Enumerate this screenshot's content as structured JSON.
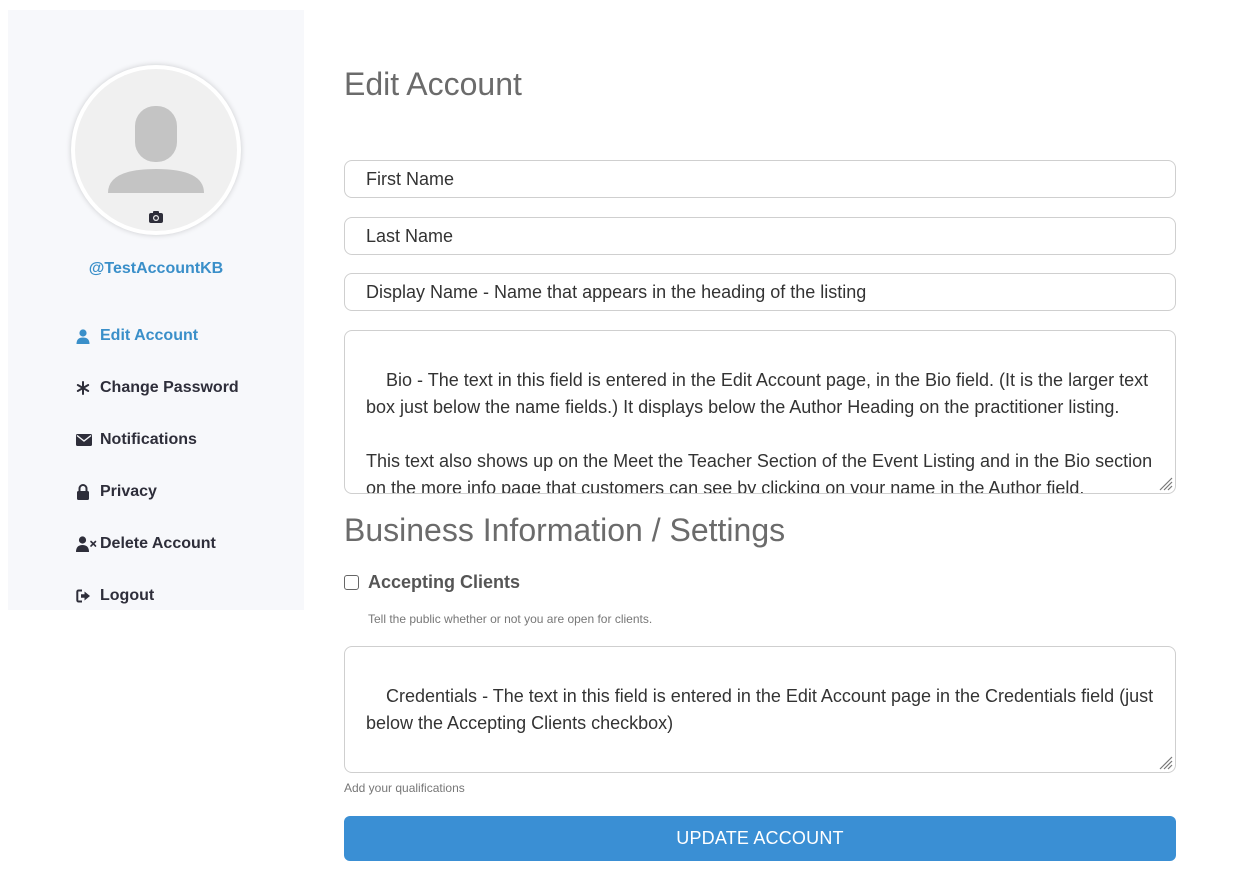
{
  "sidebar": {
    "username": "@TestAccountKB",
    "nav": [
      {
        "label": "Edit Account",
        "icon": "user-icon",
        "active": true
      },
      {
        "label": "Change Password",
        "icon": "asterisk-icon",
        "active": false
      },
      {
        "label": "Notifications",
        "icon": "envelope-icon",
        "active": false
      },
      {
        "label": "Privacy",
        "icon": "lock-icon",
        "active": false
      },
      {
        "label": "Delete Account",
        "icon": "user-times-icon",
        "active": false
      },
      {
        "label": "Logout",
        "icon": "sign-out-icon",
        "active": false
      }
    ]
  },
  "main": {
    "title": "Edit Account",
    "first_name": "First Name",
    "last_name": "Last Name",
    "display_name": "Display Name - Name that appears in the heading of the listing",
    "bio": "Bio - The text in this field is entered in the Edit Account page, in the Bio field. (It is the larger text box just below the name fields.) It displays below the Author Heading on the practitioner listing.\n\nThis text also shows up on the Meet the Teacher Section of the Event Listing and in the Bio section on the more info page that customers can see by clicking on your name in the Author field.",
    "section_title": "Business Information / Settings",
    "accepting_clients_label": "Accepting Clients",
    "accepting_clients_checked": false,
    "accepting_clients_help": "Tell the public whether or not you are open for clients.",
    "credentials": "Credentials - The text in this field is entered in the Edit Account page in the Credentials field (just below the Accepting Clients checkbox)",
    "credentials_help": "Add your qualifications",
    "update_button": "UPDATE ACCOUNT"
  },
  "colors": {
    "accent": "#3a8fc9",
    "button": "#3a8fd4",
    "sidebar_bg": "#f7f8fb"
  }
}
